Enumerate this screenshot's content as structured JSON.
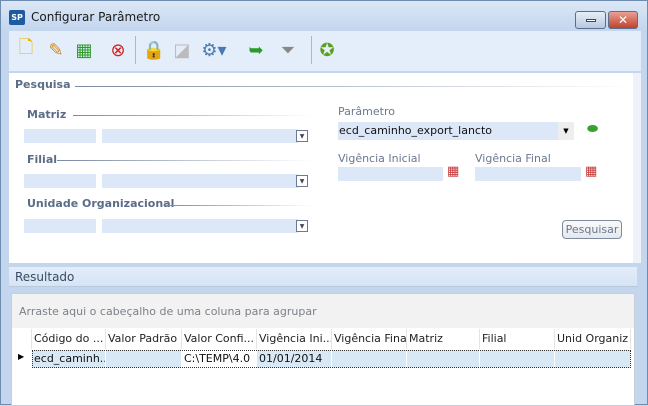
{
  "window": {
    "title": "Configurar Parâmetro",
    "app_icon": "SP"
  },
  "toolbar": {
    "buttons": [
      "new-icon",
      "edit-icon",
      "add-row-icon",
      "delete-icon",
      "lock-icon",
      "ruler-icon",
      "config-icon",
      "export-icon",
      "filter-icon",
      "favorite-icon"
    ]
  },
  "search": {
    "title": "Pesquisa",
    "matriz_label": "Matriz",
    "filial_label": "Filial",
    "unidade_label": "Unidade Organizacional",
    "parametro_label": "Parâmetro",
    "parametro_value": "ecd_caminho_export_lancto",
    "vig_ini_label": "Vigência Inicial",
    "vig_fim_label": "Vigência Final",
    "pesquisar": "Pesquisar"
  },
  "result": {
    "title": "Resultado",
    "group_hint": "Arraste aqui o cabeçalho de uma coluna para agrupar",
    "columns": [
      "Código do ...",
      "Valor Padrão",
      "Valor Confi...",
      "Vigência Ini...",
      "Vigência Final",
      "Matriz",
      "Filial",
      "Unid Organiz"
    ],
    "rows": [
      [
        "ecd_caminh...",
        "",
        "C:\\TEMP\\4.0",
        "01/01/2014",
        "",
        "",
        "",
        ""
      ]
    ]
  }
}
